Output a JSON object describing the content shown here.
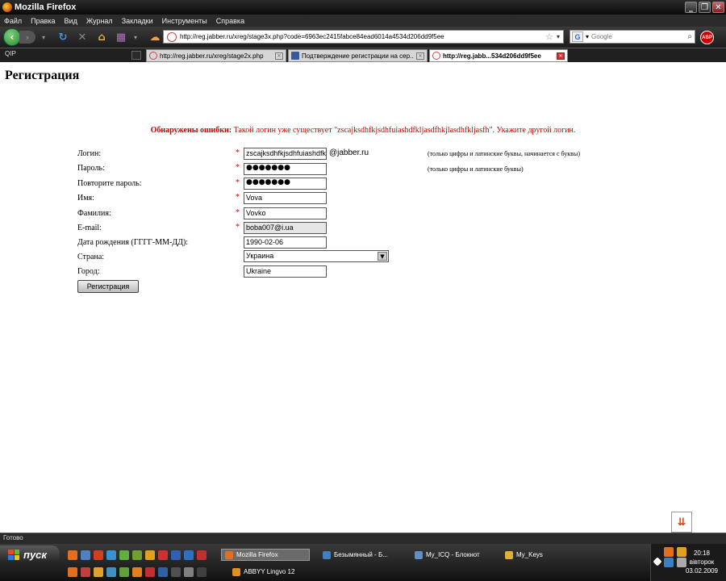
{
  "window": {
    "title": "Mozilla Firefox"
  },
  "menu": [
    "Файл",
    "Правка",
    "Вид",
    "Журнал",
    "Закладки",
    "Инструменты",
    "Справка"
  ],
  "nav": {
    "url": "http://reg.jabber.ru/xreg/stage3x.php?code=6963ec2415fabce84ead6014a4534d206dd9f5ee",
    "search_placeholder": "Google"
  },
  "bookmarks": {
    "qip": "QIP"
  },
  "tabs": [
    {
      "label": "http://reg.jabber.ru/xreg/stage2x.php",
      "active": false
    },
    {
      "label": "Подтверждение регистрации на сер...",
      "active": false
    },
    {
      "label": "http://reg.jabb...534d206dd9f5ee",
      "active": true
    }
  ],
  "page": {
    "heading": "Регистрация",
    "error_prefix": "Обнаружены ошибки:",
    "error_text": " Такой логин уже существует \"zscajksdhfkjsdhfuiashdfkljasdfhkjlasdhfkljasfh\". Укажите другой логин.",
    "domain_suffix": "@jabber.ru",
    "fields": {
      "login": {
        "label": "Логин:",
        "value": "zscajksdhfkjsdhfuiashdfkljasdfhkjlasdhfkljasfh",
        "required": "*",
        "hint": "(только цифры и латинские буквы, начинается с буквы)"
      },
      "password": {
        "label": "Пароль:",
        "value": "●●●●●●●",
        "required": "*",
        "hint": "(только цифры и латинские буквы)"
      },
      "password2": {
        "label": "Повторите пароль:",
        "value": "●●●●●●●",
        "required": "*"
      },
      "name": {
        "label": "Имя:",
        "value": "Vova",
        "required": "*"
      },
      "surname": {
        "label": "Фамилия:",
        "value": "Vovko",
        "required": "*"
      },
      "email": {
        "label": "E-mail:",
        "value": "boba007@i.ua",
        "required": "*"
      },
      "birthdate": {
        "label": "Дата рождения (ГГГГ-ММ-ДД):",
        "value": "1990-02-06"
      },
      "country": {
        "label": "Страна:",
        "value": "Украина"
      },
      "city": {
        "label": "Город:",
        "value": "Ukraine"
      }
    },
    "submit_label": "Регистрация"
  },
  "status": {
    "text": "Готово"
  },
  "taskbar": {
    "start_label": "пуск",
    "buttons": [
      {
        "label": "Mozilla Firefox",
        "active": true
      },
      {
        "label": "Безымянный - Б...",
        "active": false
      },
      {
        "label": "My_ICQ - Блокнот",
        "active": false
      },
      {
        "label": "My_Keys",
        "active": false
      },
      {
        "label": "ABBYY Lingvo 12",
        "active": false
      }
    ],
    "clock": {
      "time": "20:18",
      "day": "вівторок",
      "date": "03.02.2009"
    }
  },
  "colors": {
    "error": "#cc0000",
    "required": "#cc0000"
  }
}
